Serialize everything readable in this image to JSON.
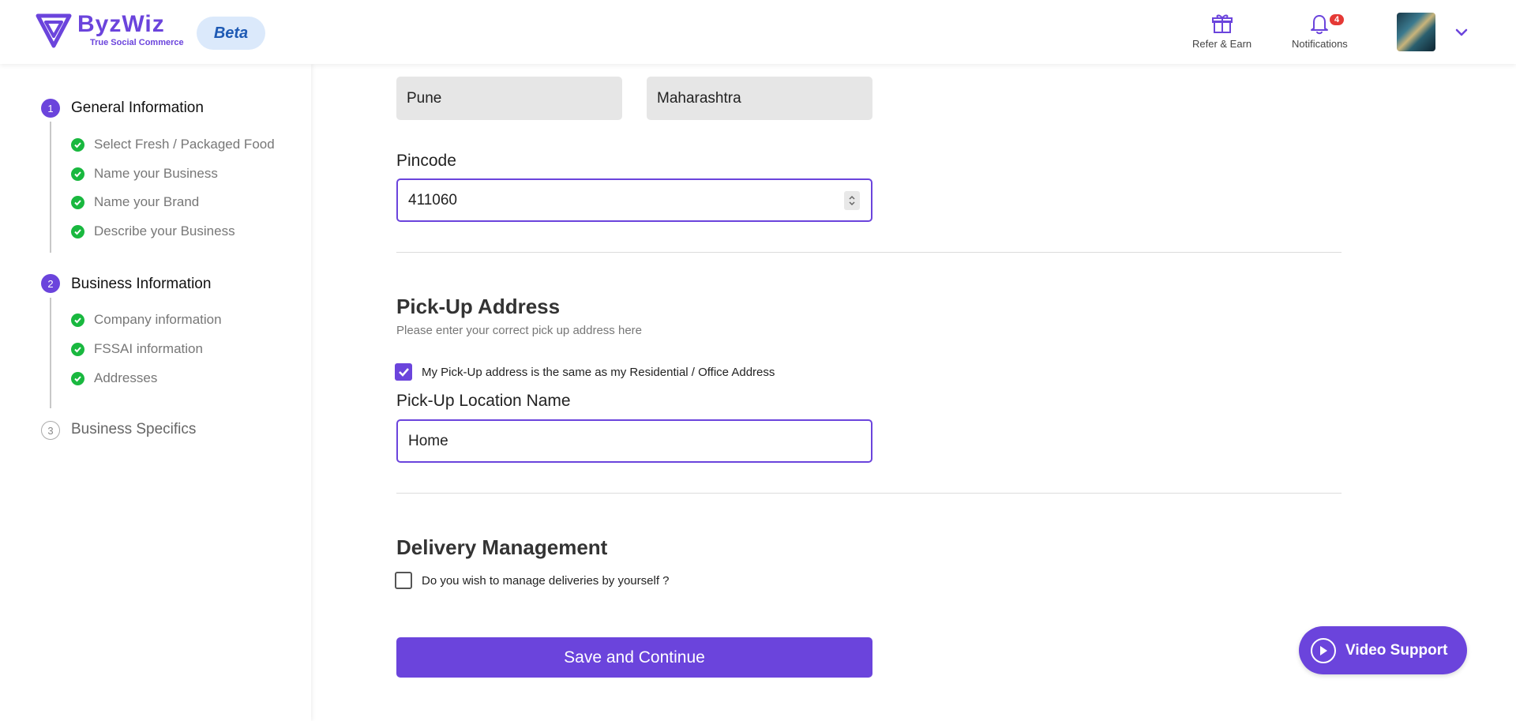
{
  "header": {
    "logo_name": "ByzWiz",
    "logo_tagline": "True Social Commerce",
    "beta_label": "Beta",
    "refer_label": "Refer & Earn",
    "notifications_label": "Notifications",
    "notifications_count": "4"
  },
  "sidebar": {
    "steps": [
      {
        "num": "1",
        "title": "General Information",
        "items": [
          "Select Fresh / Packaged Food",
          "Name your Business",
          "Name your Brand",
          "Describe your Business"
        ]
      },
      {
        "num": "2",
        "title": "Business Information",
        "items": [
          "Company information",
          "FSSAI information",
          "Addresses"
        ]
      },
      {
        "num": "3",
        "title": "Business Specifics",
        "items": []
      }
    ]
  },
  "form": {
    "city_value": "Pune",
    "state_value": "Maharashtra",
    "pincode_label": "Pincode",
    "pincode_value": "411060",
    "pickup_title": "Pick-Up Address",
    "pickup_subtitle": "Please enter your correct pick up address here",
    "same_address_label": "My Pick-Up address is the same as my Residential / Office Address",
    "same_address_checked": true,
    "location_name_label": "Pick-Up Location Name",
    "location_name_value": "Home",
    "delivery_title": "Delivery Management",
    "delivery_self_label": "Do you wish to manage deliveries by yourself ?",
    "delivery_self_checked": false,
    "save_button": "Save and Continue"
  },
  "video_support_label": "Video Support",
  "colors": {
    "accent": "#6b44dc",
    "success": "#19b83f",
    "badge": "#e53935"
  }
}
